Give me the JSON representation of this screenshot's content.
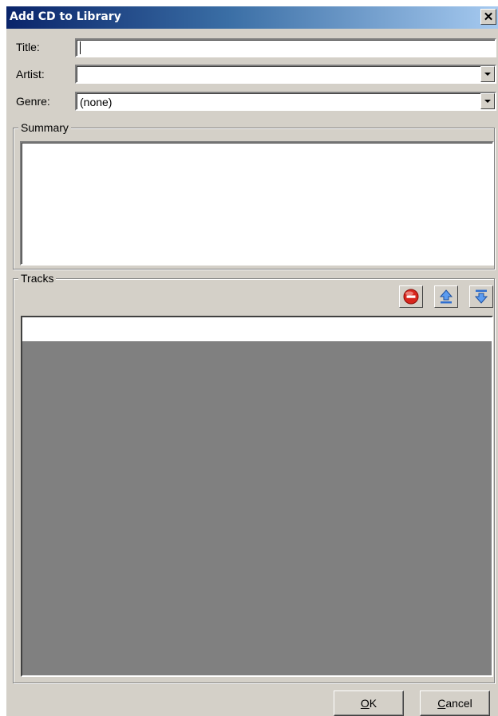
{
  "window": {
    "title": "Add CD to Library",
    "close_glyph": "✕"
  },
  "form": {
    "title_label": "Title:",
    "title_value": "",
    "artist_label": "Artist:",
    "artist_value": "",
    "genre_label": "Genre:",
    "genre_value": "(none)"
  },
  "summary": {
    "legend": "Summary",
    "value": ""
  },
  "tracks": {
    "legend": "Tracks",
    "toolbar": [
      {
        "icon": "remove-icon"
      },
      {
        "icon": "move-up-icon"
      },
      {
        "icon": "move-down-icon"
      }
    ]
  },
  "buttons": {
    "ok_label": "OK",
    "cancel_label": "Cancel"
  }
}
